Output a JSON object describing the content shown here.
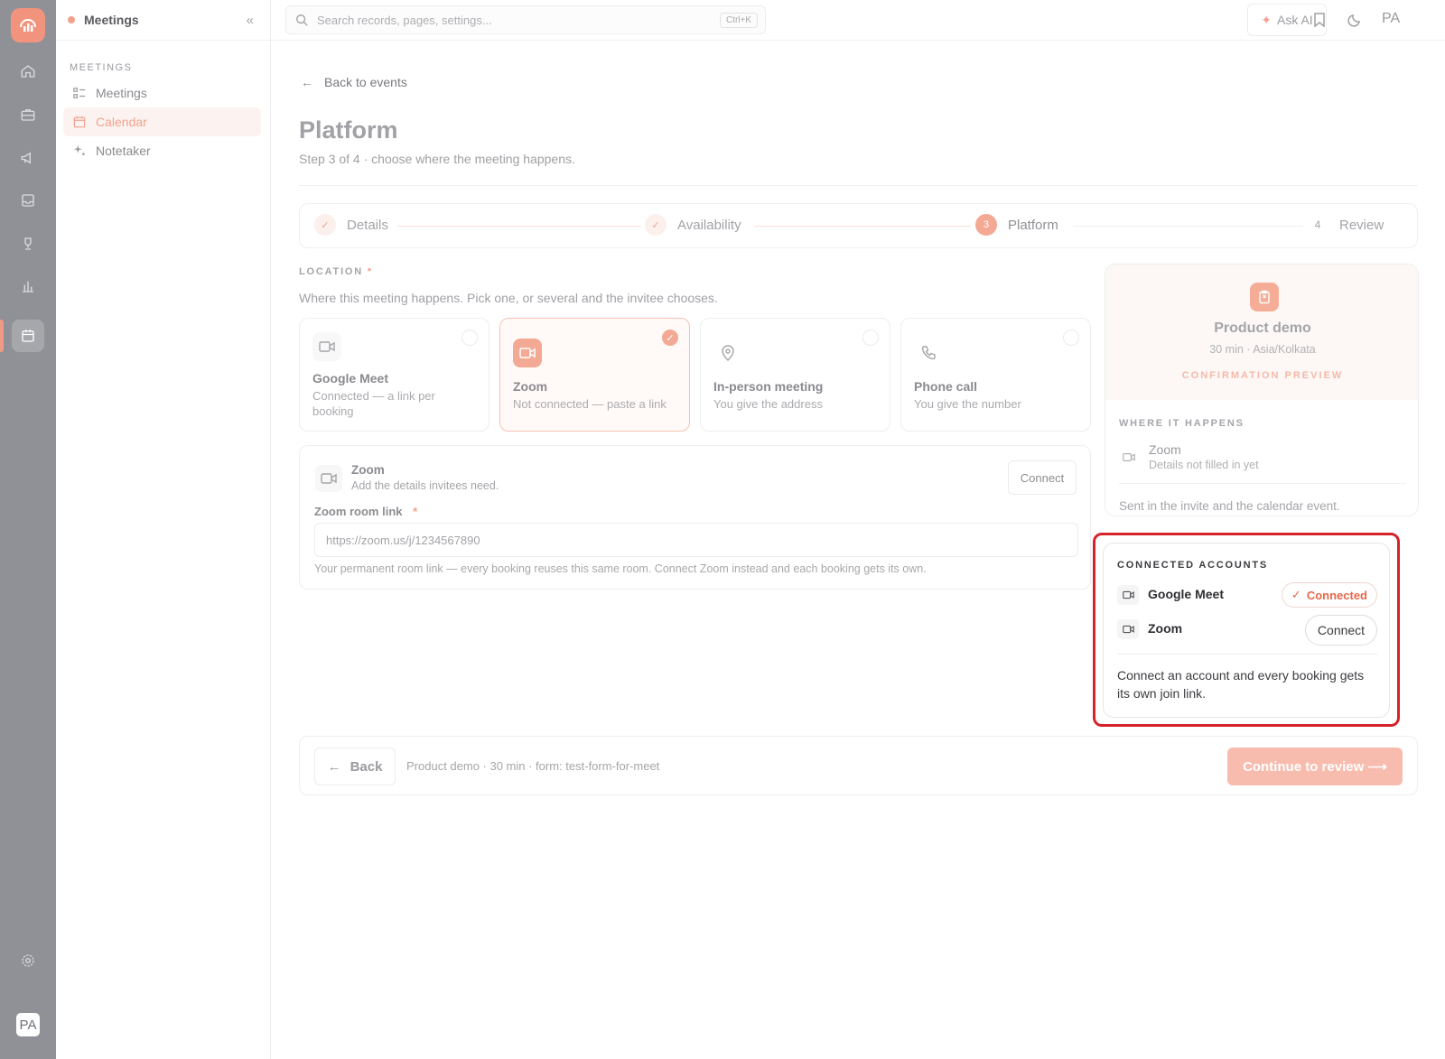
{
  "app": {
    "section_title": "Meetings"
  },
  "sidebar": {
    "section_label": "MEETINGS",
    "items": [
      {
        "label": "Meetings",
        "icon": "list-icon"
      },
      {
        "label": "Calendar",
        "icon": "calendar-icon",
        "active": true
      },
      {
        "label": "Notetaker",
        "icon": "sparkle-icon"
      }
    ]
  },
  "rail": {
    "avatar": "PA"
  },
  "topbar": {
    "search_placeholder": "Search records, pages, settings...",
    "shortcut": "Ctrl+K",
    "ask_ai": "Ask AI",
    "avatar": "PA"
  },
  "page": {
    "back": "Back to events",
    "title": "Platform",
    "subtitle": "Step 3 of 4 · choose where the meeting happens."
  },
  "stepper": {
    "steps": [
      {
        "label": "Details",
        "state": "done",
        "marker": "✓"
      },
      {
        "label": "Availability",
        "state": "done",
        "marker": "✓"
      },
      {
        "label": "Platform",
        "state": "current",
        "marker": "3"
      },
      {
        "label": "Review",
        "state": "todo",
        "marker": "4"
      }
    ]
  },
  "location": {
    "label": "LOCATION",
    "required_mark": "*",
    "help": "Where this meeting happens. Pick one, or several and the invitee chooses.",
    "options": [
      {
        "title": "Google Meet",
        "desc": "Connected — a link per booking",
        "selected": false
      },
      {
        "title": "Zoom",
        "desc": "Not connected — paste a link",
        "selected": true
      },
      {
        "title": "In-person meeting",
        "desc": "You give the address",
        "selected": false
      },
      {
        "title": "Phone call",
        "desc": "You give the number",
        "selected": false
      }
    ]
  },
  "zoom_card": {
    "title": "Zoom",
    "subtitle": "Add the details invitees need.",
    "connect": "Connect",
    "field_label": "Zoom room link",
    "required_mark": "*",
    "field_value": "https://zoom.us/j/1234567890",
    "help": "Your permanent room link — every booking reuses this same room. Connect Zoom instead and each booking gets its own."
  },
  "preview": {
    "title": "Product demo",
    "meta": "30 min · Asia/Kolkata",
    "tag": "CONFIRMATION PREVIEW",
    "where_label": "WHERE IT HAPPENS",
    "where_title": "Zoom",
    "where_sub": "Details not filled in yet",
    "note": "Sent in the invite and the calendar event."
  },
  "accounts": {
    "heading": "CONNECTED ACCOUNTS",
    "items": [
      {
        "name": "Google Meet",
        "status": "Connected"
      },
      {
        "name": "Zoom",
        "action": "Connect"
      }
    ],
    "note": "Connect an account and every booking gets its own join link."
  },
  "footer": {
    "back": "Back",
    "meta": "Product demo · 30 min · form: test-form-for-meet",
    "continue": "Continue to review ⟶"
  },
  "colors": {
    "accent": "#f4a994",
    "highlight": "#d6232a",
    "rail": "#8f9196"
  }
}
